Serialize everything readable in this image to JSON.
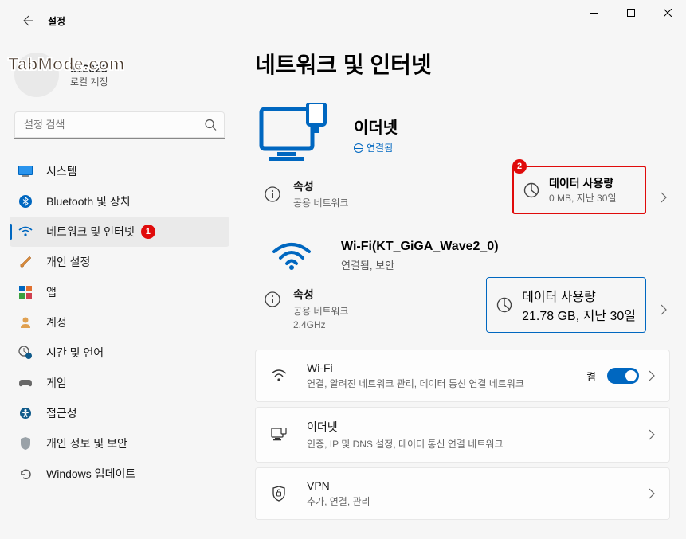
{
  "titlebar": {
    "app_title": "설정"
  },
  "watermark": "TabMode.com",
  "user": {
    "name": "e12023",
    "type": "로컬 계정"
  },
  "search": {
    "placeholder": "설정 검색"
  },
  "sidebar": {
    "items": [
      {
        "label": "시스템"
      },
      {
        "label": "Bluetooth 및 장치"
      },
      {
        "label": "네트워크 및 인터넷"
      },
      {
        "label": "개인 설정"
      },
      {
        "label": "앱"
      },
      {
        "label": "계정"
      },
      {
        "label": "시간 및 언어"
      },
      {
        "label": "게임"
      },
      {
        "label": "접근성"
      },
      {
        "label": "개인 정보 및 보안"
      },
      {
        "label": "Windows 업데이트"
      }
    ],
    "badge1": "1"
  },
  "main": {
    "title": "네트워크 및 인터넷",
    "ethernet": {
      "title": "이더넷",
      "status": "연결됨",
      "prop_title": "속성",
      "prop_sub": "공용 네트워크",
      "data_title": "데이터 사용량",
      "data_sub": "0 MB, 지난 30일",
      "badge": "2"
    },
    "wifi": {
      "title": "Wi-Fi(KT_GiGA_Wave2_0)",
      "status": "연결됨, 보안",
      "prop_title": "속성",
      "prop_sub1": "공용 네트워크",
      "prop_sub2": "2.4GHz",
      "data_title": "데이터 사용량",
      "data_sub": "21.78 GB, 지난 30일"
    },
    "cards": [
      {
        "title": "Wi-Fi",
        "sub": "연결, 알려진 네트워크 관리, 데이터 통신 연결 네트워크",
        "toggle_label": "켬",
        "has_toggle": true
      },
      {
        "title": "이더넷",
        "sub": "인증, IP 및 DNS 설정, 데이터 통신 연결 네트워크",
        "has_toggle": false
      },
      {
        "title": "VPN",
        "sub": "추가, 연결, 관리",
        "has_toggle": false
      }
    ]
  }
}
